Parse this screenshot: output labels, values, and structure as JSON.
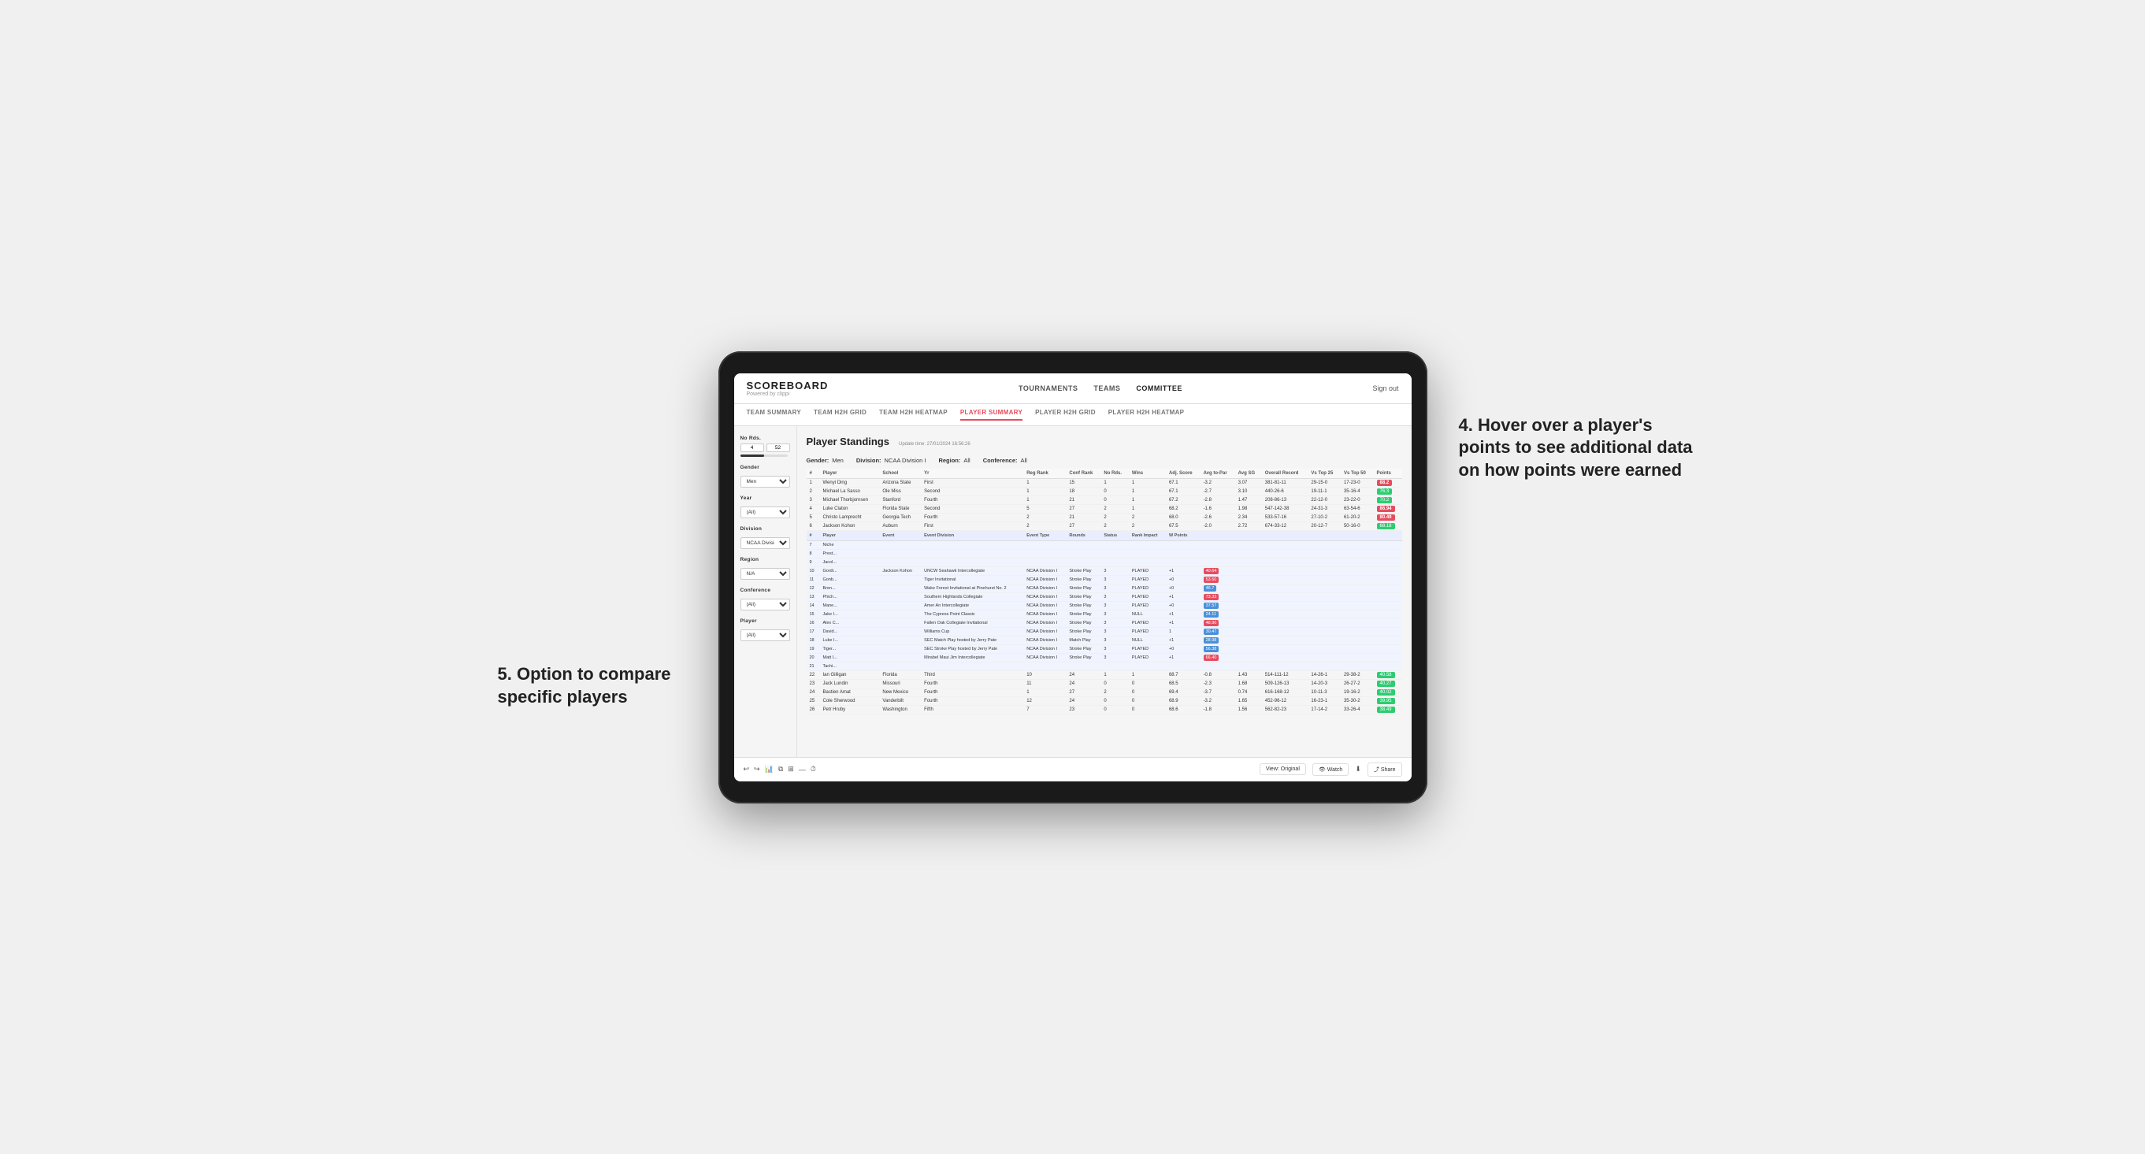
{
  "app": {
    "logo": "SCOREBOARD",
    "powered_by": "Powered by clippi",
    "sign_out": "Sign out"
  },
  "nav": {
    "links": [
      "TOURNAMENTS",
      "TEAMS",
      "COMMITTEE"
    ],
    "active": "COMMITTEE"
  },
  "sub_nav": {
    "links": [
      "TEAM SUMMARY",
      "TEAM H2H GRID",
      "TEAM H2H HEATMAP",
      "PLAYER SUMMARY",
      "PLAYER H2H GRID",
      "PLAYER H2H HEATMAP"
    ],
    "active": "PLAYER SUMMARY"
  },
  "sidebar": {
    "no_rds_label": "No Rds.",
    "no_rds_from": "4",
    "no_rds_to": "52",
    "gender_label": "Gender",
    "gender_value": "Men",
    "year_label": "Year",
    "year_value": "(All)",
    "division_label": "Division",
    "division_value": "NCAA Division I",
    "region_label": "Region",
    "region_value": "N/A",
    "conference_label": "Conference",
    "conference_value": "(All)",
    "player_label": "Player",
    "player_value": "(All)"
  },
  "standings": {
    "title": "Player Standings",
    "update_time": "Update time: 27/01/2024 16:56:26",
    "gender": "Men",
    "division": "NCAA Division I",
    "region": "All",
    "conference": "All",
    "columns": [
      "#",
      "Player",
      "School",
      "Yr",
      "Reg Rank",
      "Conf Rank",
      "No Rds.",
      "Wins",
      "Adj. Score",
      "Avg to-Par",
      "Avg SG",
      "Overall Record",
      "Vs Top 25",
      "Vs Top 50",
      "Points"
    ],
    "rows": [
      {
        "num": "1",
        "player": "Wenyi Ding",
        "school": "Arizona State",
        "yr": "First",
        "reg_rank": "1",
        "conf_rank": "15",
        "no_rds": "1",
        "wins": "1",
        "adj_score": "67.1",
        "to_par": "-3.2",
        "avg_sg": "3.07",
        "record": "381-81-11",
        "vs25": "29-15-0",
        "vs50": "17-23-0",
        "points": "88.2",
        "points_class": "red"
      },
      {
        "num": "2",
        "player": "Michael La Sasso",
        "school": "Ole Miss",
        "yr": "Second",
        "reg_rank": "1",
        "conf_rank": "18",
        "no_rds": "0",
        "wins": "1",
        "adj_score": "67.1",
        "to_par": "-2.7",
        "avg_sg": "3.10",
        "record": "440-26-6",
        "vs25": "19-11-1",
        "vs50": "35-16-4",
        "points": "76.3",
        "points_class": "green"
      },
      {
        "num": "3",
        "player": "Michael Thorbjornsen",
        "school": "Stanford",
        "yr": "Fourth",
        "reg_rank": "1",
        "conf_rank": "21",
        "no_rds": "0",
        "wins": "1",
        "adj_score": "67.2",
        "to_par": "-2.8",
        "avg_sg": "1.47",
        "record": "208-86-13",
        "vs25": "22-12-0",
        "vs50": "23-22-0",
        "points": "70.2",
        "points_class": "green"
      },
      {
        "num": "4",
        "player": "Luke Claton",
        "school": "Florida State",
        "yr": "Second",
        "reg_rank": "5",
        "conf_rank": "27",
        "no_rds": "2",
        "wins": "1",
        "adj_score": "68.2",
        "to_par": "-1.6",
        "avg_sg": "1.98",
        "record": "547-142-38",
        "vs25": "24-31-3",
        "vs50": "63-54-6",
        "points": "86.94",
        "points_class": "red"
      },
      {
        "num": "5",
        "player": "Christo Lamprecht",
        "school": "Georgia Tech",
        "yr": "Fourth",
        "reg_rank": "2",
        "conf_rank": "21",
        "no_rds": "2",
        "wins": "2",
        "adj_score": "68.0",
        "to_par": "-2.6",
        "avg_sg": "2.34",
        "record": "533-57-16",
        "vs25": "27-10-2",
        "vs50": "61-20-2",
        "points": "80.49",
        "points_class": "red"
      },
      {
        "num": "6",
        "player": "Jackson Kohon",
        "school": "Auburn",
        "yr": "First",
        "reg_rank": "2",
        "conf_rank": "27",
        "no_rds": "2",
        "wins": "2",
        "adj_score": "67.5",
        "to_par": "-2.0",
        "avg_sg": "2.72",
        "record": "674-33-12",
        "vs25": "20-12-7",
        "vs50": "50-16-0",
        "points": "68.18",
        "points_class": "green"
      }
    ],
    "tooltip_header": [
      "Player",
      "Event",
      "Event Division",
      "Event Type",
      "Rounds",
      "Status",
      "Rank Impact",
      "W Points"
    ],
    "tooltip_rows": [
      {
        "player": "Jackson Kohon",
        "event": "UNCW Seahawk Intercollegiate",
        "division": "NCAA Division I",
        "type": "Stroke Play",
        "rounds": "3",
        "status": "PLAYED",
        "impact": "+1",
        "points": "40.64"
      },
      {
        "player": "",
        "event": "Tiger Invitational",
        "division": "NCAA Division I",
        "type": "Stroke Play",
        "rounds": "3",
        "status": "PLAYED",
        "impact": "+0",
        "points": "53.60"
      },
      {
        "player": "",
        "event": "Wake Forest Invitational at Pinehurst No. 2",
        "division": "NCAA Division I",
        "type": "Stroke Play",
        "rounds": "3",
        "status": "PLAYED",
        "impact": "+0",
        "points": "46.7"
      },
      {
        "player": "",
        "event": "Southern Highlands Collegiate",
        "division": "NCAA Division I",
        "type": "Stroke Play",
        "rounds": "3",
        "status": "PLAYED",
        "impact": "+1",
        "points": "73.33"
      },
      {
        "player": "",
        "event": "Amer An Intercollegiate",
        "division": "NCAA Division I",
        "type": "Stroke Play",
        "rounds": "3",
        "status": "PLAYED",
        "impact": "+0",
        "points": "37.57"
      },
      {
        "player": "",
        "event": "The Cypress Point Classic",
        "division": "NCAA Division I",
        "type": "Stroke Play",
        "rounds": "3",
        "status": "NULL",
        "impact": "+1",
        "points": "24.11"
      },
      {
        "player": "",
        "event": "Fallen Oak Collegiate Invitational",
        "division": "NCAA Division I",
        "type": "Stroke Play",
        "rounds": "3",
        "status": "PLAYED",
        "impact": "+1",
        "points": "48.90"
      },
      {
        "player": "",
        "event": "Williams Cup",
        "division": "NCAA Division I",
        "type": "Stroke Play",
        "rounds": "3",
        "status": "PLAYED",
        "impact": "1",
        "points": "30.47"
      },
      {
        "player": "",
        "event": "SEC Match Play hosted by Jerry Pate",
        "division": "NCAA Division I",
        "type": "Match Play",
        "rounds": "3",
        "status": "NULL",
        "impact": "+1",
        "points": "28.98"
      },
      {
        "player": "",
        "event": "SEC Stroke Play hosted by Jerry Pate",
        "division": "NCAA Division I",
        "type": "Stroke Play",
        "rounds": "3",
        "status": "PLAYED",
        "impact": "+0",
        "points": "56.38"
      },
      {
        "player": "",
        "event": "Mirabel Maui Jim Intercollegiate",
        "division": "NCAA Division I",
        "type": "Stroke Play",
        "rounds": "3",
        "status": "PLAYED",
        "impact": "+1",
        "points": "66.40"
      }
    ],
    "extra_rows": [
      {
        "num": "22",
        "player": "Ian Gilligan",
        "school": "Florida",
        "yr": "Third",
        "reg_rank": "10",
        "conf_rank": "24",
        "no_rds": "1",
        "wins": "1",
        "adj_score": "68.7",
        "to_par": "-0.8",
        "avg_sg": "1.43",
        "record": "514-111-12",
        "vs25": "14-26-1",
        "vs50": "29-38-2",
        "points": "40.58"
      },
      {
        "num": "23",
        "player": "Jack Lundin",
        "school": "Missouri",
        "yr": "Fourth",
        "reg_rank": "11",
        "conf_rank": "24",
        "no_rds": "0",
        "wins": "0",
        "adj_score": "68.5",
        "to_par": "-2.3",
        "avg_sg": "1.68",
        "record": "509-126-13",
        "vs25": "14-20-3",
        "vs50": "26-27-2",
        "points": "40.27"
      },
      {
        "num": "24",
        "player": "Bastien Amat",
        "school": "New Mexico",
        "yr": "Fourth",
        "reg_rank": "1",
        "conf_rank": "27",
        "no_rds": "2",
        "wins": "0",
        "adj_score": "69.4",
        "to_par": "-3.7",
        "avg_sg": "0.74",
        "record": "616-168-12",
        "vs25": "10-11-3",
        "vs50": "19-16-2",
        "points": "40.02"
      },
      {
        "num": "25",
        "player": "Cole Sherwood",
        "school": "Vanderbilt",
        "yr": "Fourth",
        "reg_rank": "12",
        "conf_rank": "24",
        "no_rds": "0",
        "wins": "0",
        "adj_score": "68.9",
        "to_par": "-3.2",
        "avg_sg": "1.65",
        "record": "452-96-12",
        "vs25": "16-23-1",
        "vs50": "35-30-2",
        "points": "39.95"
      },
      {
        "num": "26",
        "player": "Petr Hruby",
        "school": "Washington",
        "yr": "Fifth",
        "reg_rank": "7",
        "conf_rank": "23",
        "no_rds": "0",
        "wins": "0",
        "adj_score": "68.6",
        "to_par": "-1.8",
        "avg_sg": "1.56",
        "record": "562-82-23",
        "vs25": "17-14-2",
        "vs50": "33-26-4",
        "points": "38.49"
      }
    ]
  },
  "toolbar": {
    "view_label": "View: Original",
    "watch_label": "Watch",
    "share_label": "Share"
  },
  "annotations": {
    "right": "4. Hover over a player's points to see additional data on how points were earned",
    "left": "5. Option to compare specific players"
  }
}
